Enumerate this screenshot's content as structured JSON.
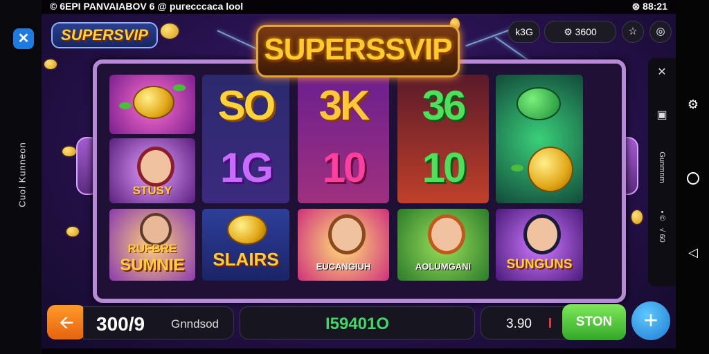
{
  "status_bar": {
    "left_text": "© 6EPI PANVAIABOV  6 @ puгесссаса lool",
    "right_text": "⊛ 88:21"
  },
  "side_caption": "Cuol Kunneon",
  "close_icon": "close-icon",
  "logo_small": "SUPERSVIP",
  "title": "SUPERSSVIP",
  "hud": {
    "pill1": "k3G",
    "pill2": "⚙ 3600",
    "circle1": "☆",
    "circle2": "◎"
  },
  "reels": {
    "col2": {
      "top": "SO",
      "middle": "1G",
      "bottom": "SLAIRS"
    },
    "col3": {
      "top": "3K",
      "middle": "10",
      "bottom": "EUCANGIUH"
    },
    "col4": {
      "top": "36",
      "middle": "10",
      "bottom": "AOLUMGANI"
    },
    "col1": {
      "middle": "STUSY",
      "bottom_line1": "RUFBRE",
      "bottom_line2": "SUMNIE"
    },
    "col5": {
      "bottom": "SUNGUNS"
    }
  },
  "bottom_bar": {
    "back_icon": "arrow-left-icon",
    "balance_value": "300/9",
    "balance_unit": "Gnndsod",
    "win_value": "I59401O",
    "bet_value": "3.90",
    "spin_label": "STON",
    "plus_label": "+"
  },
  "right_panel": {
    "item1": "✕",
    "item2": "▣",
    "rot1": "Gunmnm",
    "rot2": "• ©",
    "rot3": "√ 60"
  },
  "colors": {
    "accent_gold": "#ffcb2e",
    "spin_green": "#32a828",
    "plus_blue": "#1f7bd0",
    "back_orange": "#e66310",
    "win_green": "#44d66a"
  }
}
